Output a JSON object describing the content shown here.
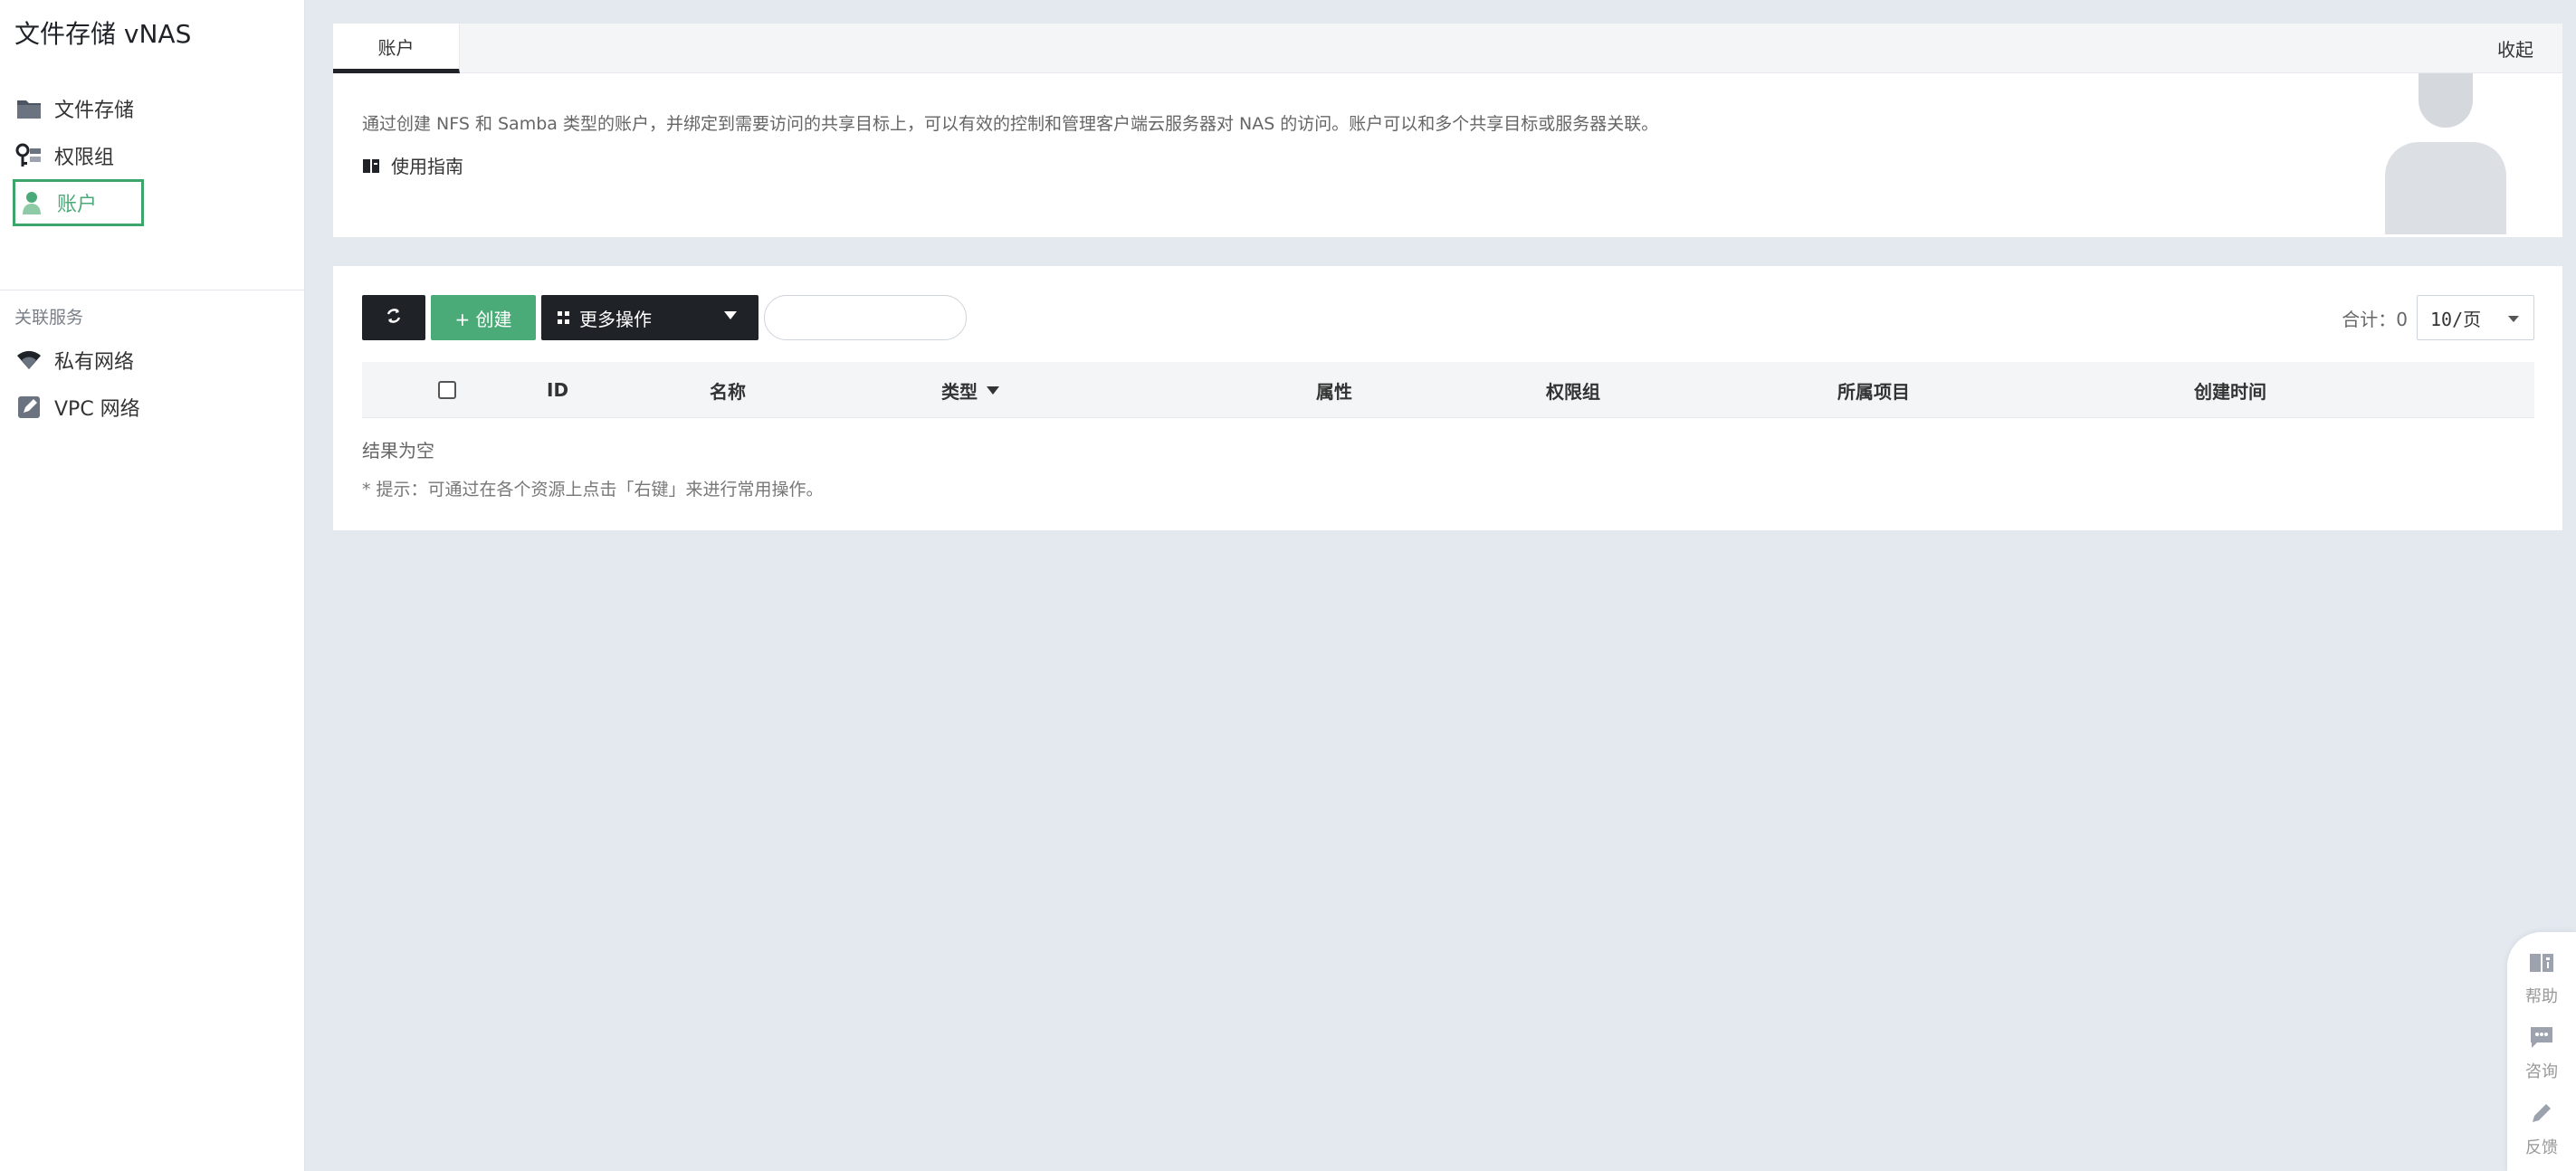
{
  "app": {
    "title": "文件存储 vNAS"
  },
  "sidebar": {
    "items": [
      {
        "label": "文件存储",
        "icon": "folder-icon"
      },
      {
        "label": "权限组",
        "icon": "permission-group-icon"
      },
      {
        "label": "账户",
        "icon": "user-icon",
        "active": true
      }
    ],
    "related_section_title": "关联服务",
    "related_items": [
      {
        "label": "私有网络",
        "icon": "wifi-icon"
      },
      {
        "label": "VPC 网络",
        "icon": "vpc-edit-icon"
      }
    ]
  },
  "top_panel": {
    "tab_label": "账户",
    "collapse_label": "收起",
    "description": "通过创建 NFS 和 Samba 类型的账户，并绑定到需要访问的共享目标上，可以有效的控制和管理客户端云服务器对 NAS 的访问。账户可以和多个共享目标或服务器关联。",
    "guide_label": "使用指南"
  },
  "toolbar": {
    "create_label": "+ 创建",
    "more_label": "更多操作",
    "search_placeholder": "",
    "total_label": "合计：0",
    "page_size": "10/页"
  },
  "table": {
    "columns": [
      "ID",
      "名称",
      "类型",
      "属性",
      "权限组",
      "所属项目",
      "创建时间"
    ],
    "empty_text": "结果为空",
    "hint": "* 提示：可通过在各个资源上点击「右键」来进行常用操作。"
  },
  "float_bar": {
    "help": "帮助",
    "consult": "咨询",
    "feedback": "反馈"
  },
  "colors": {
    "accent_green": "#4aab78",
    "dark_button": "#1f2328",
    "page_bg": "#e4e9f0"
  }
}
